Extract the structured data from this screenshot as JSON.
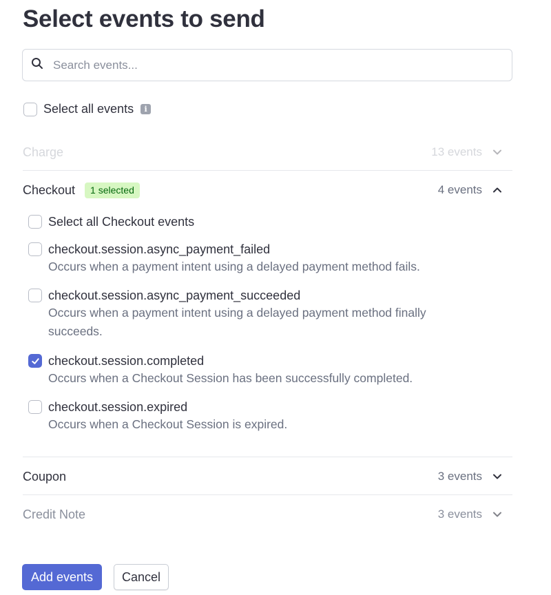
{
  "page_title": "Select events to send",
  "search": {
    "placeholder": "Search events..."
  },
  "select_all": {
    "label": "Select all events",
    "info_glyph": "i"
  },
  "groups": {
    "charge": {
      "name": "Charge",
      "count": "13 events"
    },
    "checkout": {
      "name": "Checkout",
      "badge": "1 selected",
      "count": "4 events",
      "select_all_label": "Select all Checkout events",
      "events": [
        {
          "name": "checkout.session.async_payment_failed",
          "desc": "Occurs when a payment intent using a delayed payment method fails.",
          "checked": false
        },
        {
          "name": "checkout.session.async_payment_succeeded",
          "desc": "Occurs when a payment intent using a delayed payment method finally succeeds.",
          "checked": false
        },
        {
          "name": "checkout.session.completed",
          "desc": "Occurs when a Checkout Session has been successfully completed.",
          "checked": true
        },
        {
          "name": "checkout.session.expired",
          "desc": "Occurs when a Checkout Session is expired.",
          "checked": false
        }
      ]
    },
    "coupon": {
      "name": "Coupon",
      "count": "3 events"
    },
    "credit_note": {
      "name": "Credit Note",
      "count": "3 events"
    }
  },
  "buttons": {
    "add": "Add events",
    "cancel": "Cancel"
  },
  "colors": {
    "accent": "#5469d4",
    "badge_bg": "#d7f7c2",
    "badge_text": "#05690d",
    "text": "#30313d",
    "muted": "#6a7080"
  },
  "icons": {
    "search": "search-icon",
    "chevron_down": "chevron-down-icon",
    "chevron_up": "chevron-up-icon",
    "info": "info-icon",
    "check": "check-icon"
  }
}
